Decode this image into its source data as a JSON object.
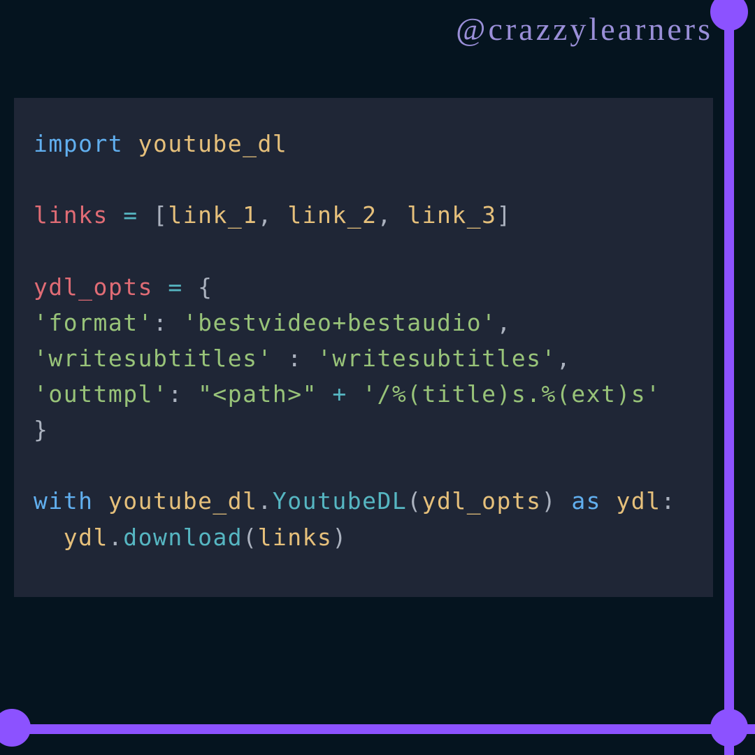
{
  "handle": "@crazzylearners",
  "code": {
    "tokens": [
      [
        [
          "kw",
          "import"
        ],
        [
          "sp",
          " "
        ],
        [
          "mod",
          "youtube_dl"
        ]
      ],
      [],
      [
        [
          "var",
          "links"
        ],
        [
          "sp",
          " "
        ],
        [
          "op",
          "="
        ],
        [
          "sp",
          " "
        ],
        [
          "pun",
          "["
        ],
        [
          "mod",
          "link_1"
        ],
        [
          "pun",
          ","
        ],
        [
          "sp",
          " "
        ],
        [
          "mod",
          "link_2"
        ],
        [
          "pun",
          ","
        ],
        [
          "sp",
          " "
        ],
        [
          "mod",
          "link_3"
        ],
        [
          "pun",
          "]"
        ]
      ],
      [],
      [
        [
          "var",
          "ydl_opts"
        ],
        [
          "sp",
          " "
        ],
        [
          "op",
          "="
        ],
        [
          "sp",
          " "
        ],
        [
          "pun",
          "{"
        ]
      ],
      [
        [
          "str",
          "'format'"
        ],
        [
          "pun",
          ":"
        ],
        [
          "sp",
          " "
        ],
        [
          "str",
          "'bestvideo+bestaudio'"
        ],
        [
          "pun",
          ","
        ]
      ],
      [
        [
          "str",
          "'writesubtitles'"
        ],
        [
          "sp",
          " "
        ],
        [
          "pun",
          ":"
        ],
        [
          "sp",
          " "
        ],
        [
          "str",
          "'writesubtitles'"
        ],
        [
          "pun",
          ","
        ]
      ],
      [
        [
          "str",
          "'outtmpl'"
        ],
        [
          "pun",
          ":"
        ],
        [
          "sp",
          " "
        ],
        [
          "str",
          "\"<path>\""
        ],
        [
          "sp",
          " "
        ],
        [
          "op",
          "+"
        ],
        [
          "sp",
          " "
        ],
        [
          "str",
          "'/%(title)s.%(ext)s'"
        ]
      ],
      [
        [
          "pun",
          "}"
        ]
      ],
      [],
      [
        [
          "kw",
          "with"
        ],
        [
          "sp",
          " "
        ],
        [
          "mod",
          "youtube_dl"
        ],
        [
          "pun",
          "."
        ],
        [
          "fn",
          "YoutubeDL"
        ],
        [
          "pun",
          "("
        ],
        [
          "mod",
          "ydl_opts"
        ],
        [
          "pun",
          ")"
        ],
        [
          "sp",
          " "
        ],
        [
          "kw",
          "as"
        ],
        [
          "sp",
          " "
        ],
        [
          "mod",
          "ydl"
        ],
        [
          "pun",
          ":"
        ]
      ],
      [
        [
          "sp",
          "  "
        ],
        [
          "mod",
          "ydl"
        ],
        [
          "pun",
          "."
        ],
        [
          "fn",
          "download"
        ],
        [
          "pun",
          "("
        ],
        [
          "mod",
          "links"
        ],
        [
          "pun",
          ")"
        ]
      ]
    ]
  }
}
